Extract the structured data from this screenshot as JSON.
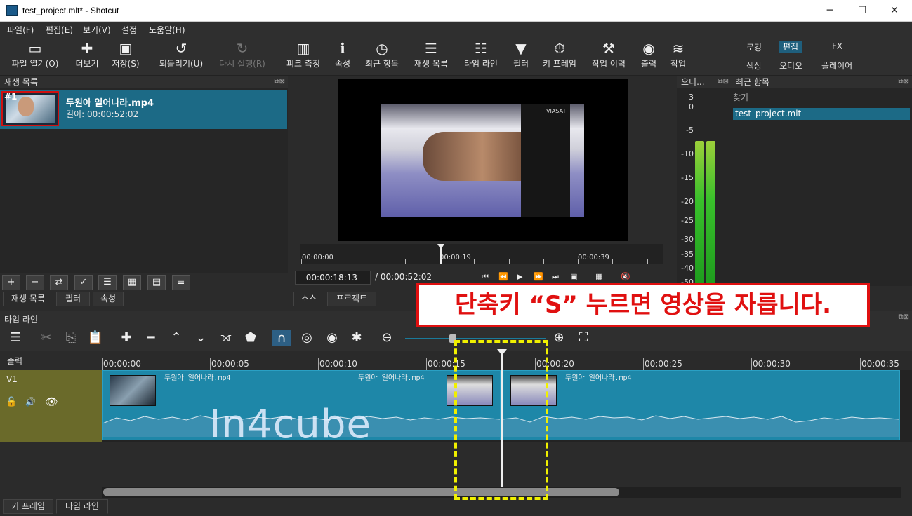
{
  "window": {
    "title": "test_project.mlt* - Shotcut",
    "minimize": "─",
    "maximize": "☐",
    "close": "✕"
  },
  "menu": [
    "파일(F)",
    "편집(E)",
    "보기(V)",
    "설정",
    "도움말(H)"
  ],
  "toolbar": [
    {
      "icon": "folder-open-icon",
      "glyph": "▭",
      "label": "파일 열기(O)"
    },
    {
      "icon": "more-icon",
      "glyph": "✚",
      "label": "더보기"
    },
    {
      "icon": "save-icon",
      "glyph": "▣",
      "label": "저장(S)"
    },
    {
      "icon": "undo-icon",
      "glyph": "↺",
      "label": "되돌리기(U)"
    },
    {
      "icon": "redo-icon",
      "glyph": "↻",
      "label": "다시 실행(R)"
    },
    {
      "icon": "peak-meter-icon",
      "glyph": "▥",
      "label": "피크 측정"
    },
    {
      "icon": "properties-icon",
      "glyph": "ℹ",
      "label": "속성"
    },
    {
      "icon": "recent-icon",
      "glyph": "◷",
      "label": "최근 항목"
    },
    {
      "icon": "playlist-icon",
      "glyph": "☰",
      "label": "재생 목록"
    },
    {
      "icon": "timeline-icon",
      "glyph": "☷",
      "label": "타임 라인"
    },
    {
      "icon": "filter-icon",
      "glyph": "▼",
      "label": "필터"
    },
    {
      "icon": "keyframe-icon",
      "glyph": "⏱",
      "label": "키 프레임"
    },
    {
      "icon": "history-icon",
      "glyph": "⚒",
      "label": "작업 이력"
    },
    {
      "icon": "export-icon",
      "glyph": "◉",
      "label": "출력"
    },
    {
      "icon": "jobs-icon",
      "glyph": "≋",
      "label": "작업"
    }
  ],
  "layouts": {
    "row1": [
      "로깅",
      "편집",
      "FX"
    ],
    "row2": [
      "색상",
      "오디오",
      "플레이어"
    ],
    "active": "편집"
  },
  "playlist": {
    "title": "재생 목록",
    "item": {
      "number": "#1",
      "name": "두원아 일어나라.mp4",
      "duration": "길이: 00:00:52;02"
    },
    "buttons": [
      "+",
      "−",
      "⇄",
      "✓",
      "☰",
      "▦",
      "▤",
      "≡"
    ],
    "tabs": [
      "재생 목록",
      "필터",
      "속성"
    ]
  },
  "player": {
    "logo": "VIASAT",
    "ticks": [
      "00:00:00",
      "00:00:19",
      "00:00:39"
    ],
    "current_time": "00:00:18:13",
    "duration": "/ 00:00:52:02",
    "controls": [
      "⏮",
      "⏪",
      "▶",
      "⏩",
      "⏭",
      "▣",
      "▦",
      "🔇"
    ],
    "tabs": [
      "소스",
      "프로젝트"
    ]
  },
  "audio": {
    "title": "오디...",
    "scale": [
      "3",
      "0",
      "-5",
      "-10",
      "-15",
      "-20",
      "-25",
      "-30",
      "-35",
      "-40",
      "-50"
    ]
  },
  "recent": {
    "title": "최근 항목",
    "search_placeholder": "찾기",
    "items": [
      "test_project.mlt"
    ]
  },
  "timeline": {
    "title": "타임 라인",
    "output_label": "출력",
    "track": "V1",
    "ruler": [
      "00:00:00",
      "00:00:05",
      "00:00:10",
      "00:00:15",
      "00:00:20",
      "00:00:25",
      "00:00:30",
      "00:00:35"
    ],
    "clip_name": "두원아 일어나라.mp4",
    "tools": [
      {
        "name": "menu-icon",
        "g": "☰"
      },
      {
        "name": "cut-icon",
        "g": "✂"
      },
      {
        "name": "copy-icon",
        "g": "⎘"
      },
      {
        "name": "paste-icon",
        "g": "📋"
      },
      {
        "name": "append-icon",
        "g": "✚"
      },
      {
        "name": "remove-icon",
        "g": "━"
      },
      {
        "name": "lift-icon",
        "g": "⌃"
      },
      {
        "name": "overwrite-icon",
        "g": "⌄"
      },
      {
        "name": "split-icon",
        "g": "⟗"
      },
      {
        "name": "marker-icon",
        "g": "⬟"
      },
      {
        "name": "snap-icon",
        "g": "∩"
      },
      {
        "name": "scrub-icon",
        "g": "◎"
      },
      {
        "name": "ripple-icon",
        "g": "◉"
      },
      {
        "name": "ripple-all-icon",
        "g": "✱"
      },
      {
        "name": "zoom-out-icon",
        "g": "⊖"
      },
      {
        "name": "zoom-in-icon",
        "g": "⊕"
      },
      {
        "name": "zoom-fit-icon",
        "g": "⛶"
      }
    ],
    "bottom_tabs": [
      "키 프레임",
      "타임 라인"
    ]
  },
  "annotation": {
    "callout": "단축키 “S” 누르면 영상을 자릅니다.",
    "watermark": "In4cube"
  }
}
